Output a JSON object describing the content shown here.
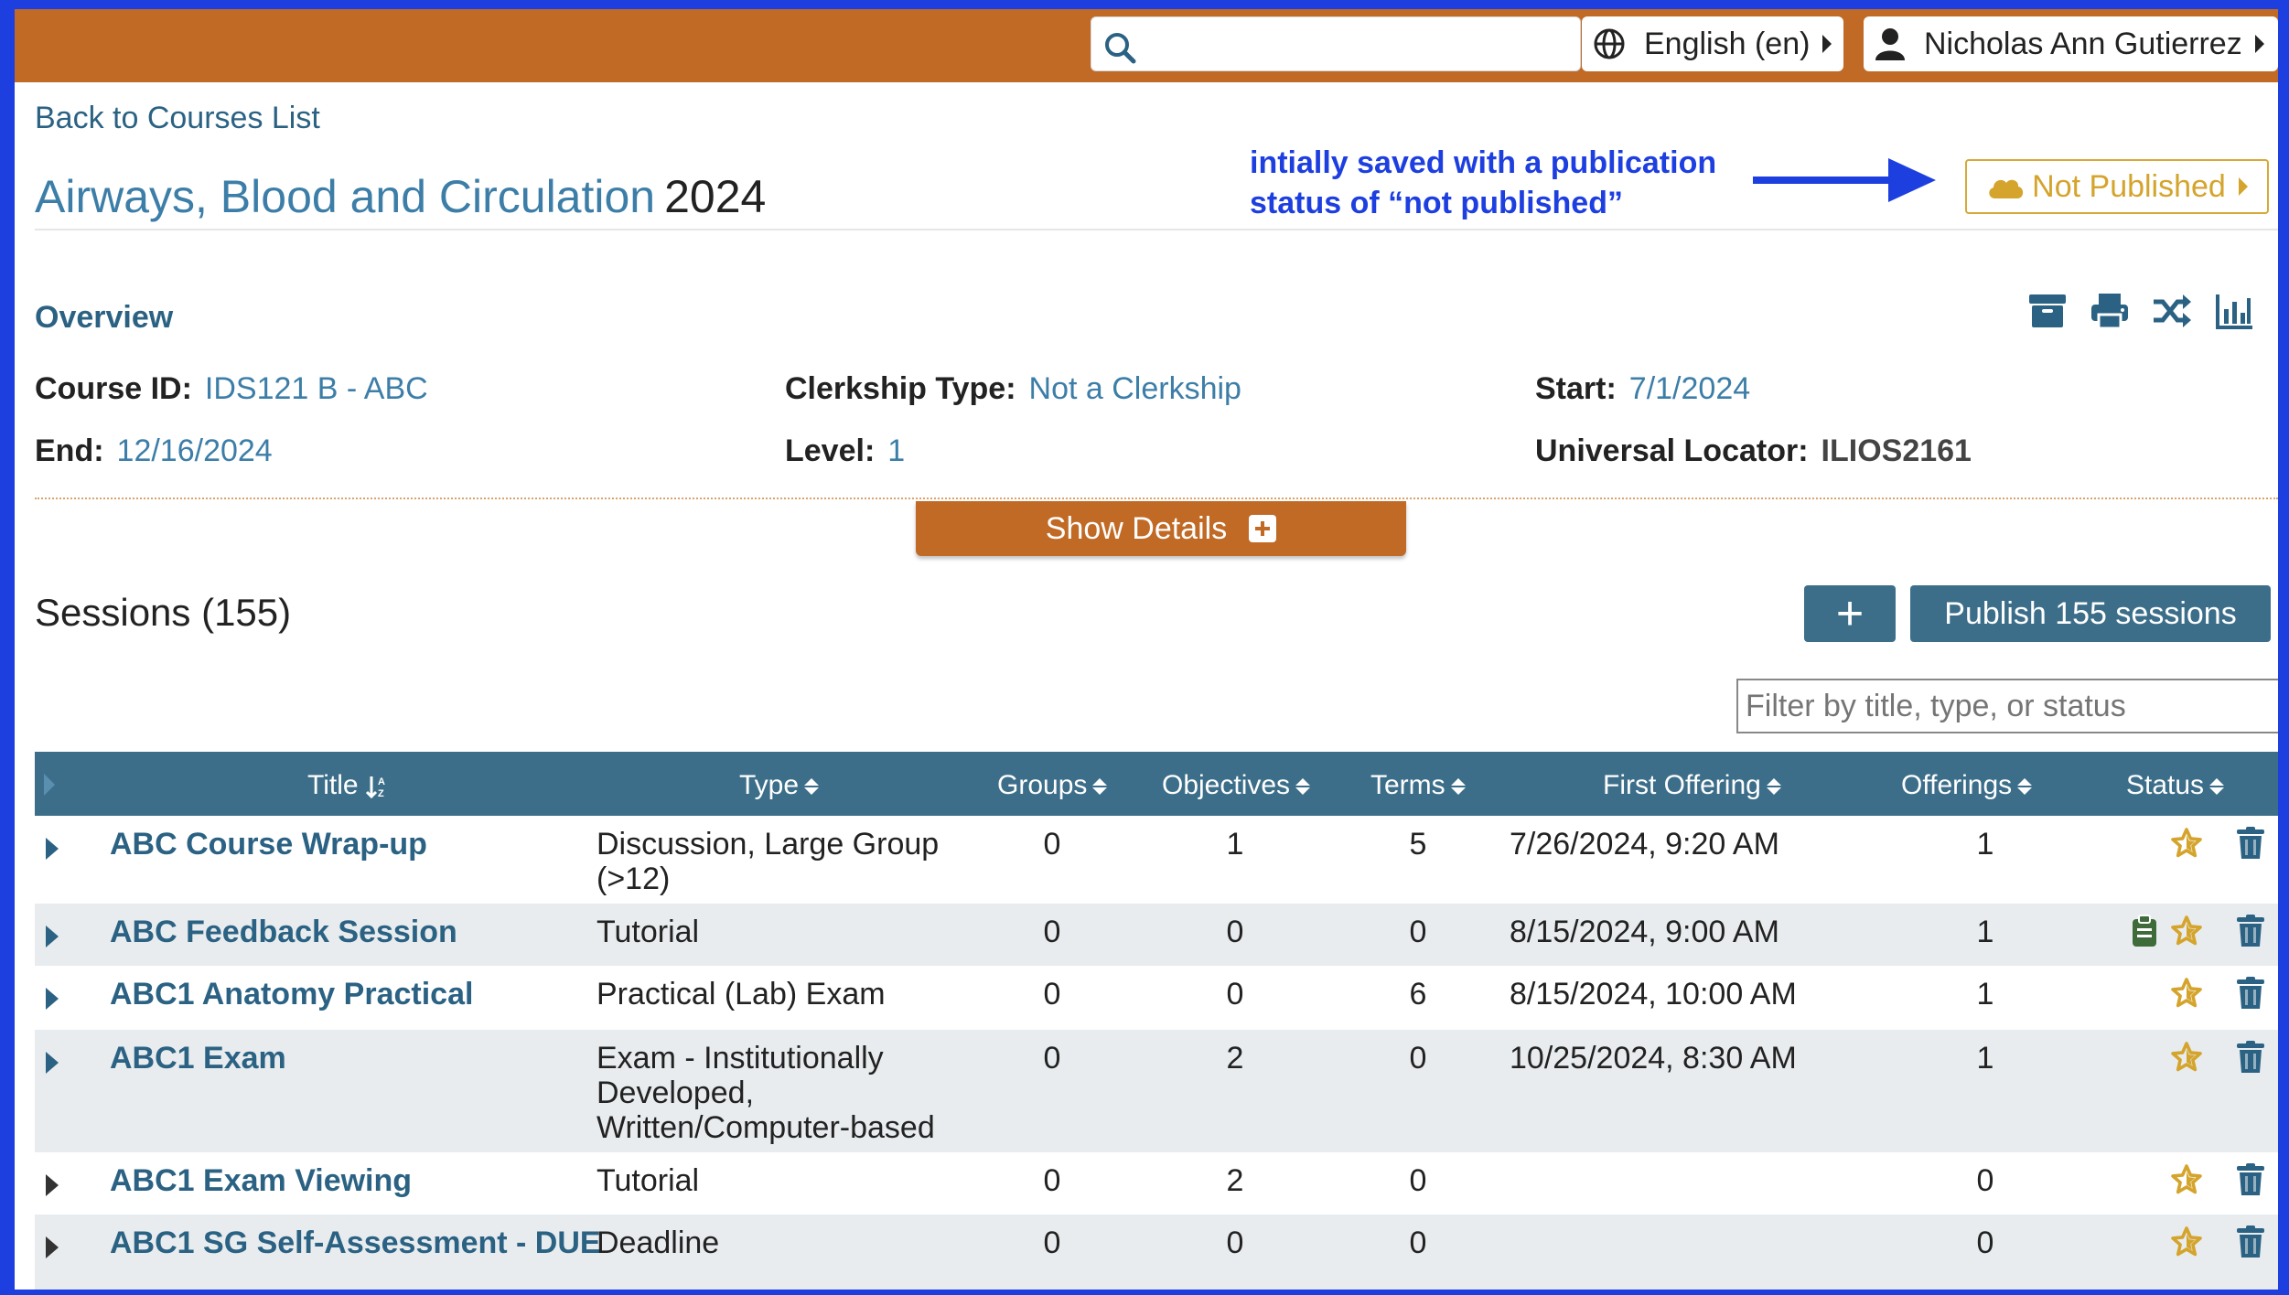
{
  "header": {
    "search_placeholder": "",
    "language": "English (en)",
    "user_name": "Nicholas Ann Gutierrez"
  },
  "nav": {
    "back_link": "Back to Courses List"
  },
  "course": {
    "title": "Airways, Blood and Circulation",
    "year": "2024",
    "publish_status": "Not Published"
  },
  "annotation": {
    "line1": "intially saved with a publication",
    "line2": "status of “not published”"
  },
  "overview": {
    "heading": "Overview",
    "fields": {
      "course_id_label": "Course ID:",
      "course_id": "IDS121 B - ABC",
      "clerkship_label": "Clerkship Type:",
      "clerkship": "Not a Clerkship",
      "start_label": "Start:",
      "start": "7/1/2024",
      "end_label": "End:",
      "end": "12/16/2024",
      "level_label": "Level:",
      "level": "1",
      "locator_label": "Universal Locator:",
      "locator": "ILIOS2161"
    },
    "show_details": "Show Details",
    "tool_icons": [
      "archive-icon",
      "print-icon",
      "shuffle-icon",
      "chart-icon"
    ]
  },
  "sessions": {
    "heading": "Sessions (155)",
    "add_label": "+",
    "publish_label": "Publish 155 sessions",
    "filter_placeholder": "Filter by title, type, or status",
    "columns": {
      "title": "Title",
      "type": "Type",
      "groups": "Groups",
      "objectives": "Objectives",
      "terms": "Terms",
      "first_offering": "First Offering",
      "offerings": "Offerings",
      "status": "Status"
    },
    "rows": [
      {
        "title": "ABC Course Wrap-up",
        "type": "Discussion, Large Group (>12)",
        "groups": "0",
        "objectives": "1",
        "terms": "5",
        "first_offering": "7/26/2024, 9:20 AM",
        "offerings": "1",
        "status_icons": [
          "star-icon"
        ],
        "expand_color": "#2b6283"
      },
      {
        "title": "ABC Feedback Session",
        "type": "Tutorial",
        "groups": "0",
        "objectives": "0",
        "terms": "0",
        "first_offering": "8/15/2024, 9:00 AM",
        "offerings": "1",
        "status_icons": [
          "clipboard-icon",
          "star-icon"
        ],
        "expand_color": "#2b6283"
      },
      {
        "title": "ABC1 Anatomy Practical",
        "type": "Practical (Lab) Exam",
        "groups": "0",
        "objectives": "0",
        "terms": "6",
        "first_offering": "8/15/2024, 10:00 AM",
        "offerings": "1",
        "status_icons": [
          "star-icon"
        ],
        "expand_color": "#2b6283"
      },
      {
        "title": "ABC1 Exam",
        "type": "Exam - Institutionally Developed, Written/Computer-based",
        "groups": "0",
        "objectives": "2",
        "terms": "0",
        "first_offering": "10/25/2024, 8:30 AM",
        "offerings": "1",
        "status_icons": [
          "star-icon"
        ],
        "expand_color": "#2b6283"
      },
      {
        "title": "ABC1 Exam Viewing",
        "type": "Tutorial",
        "groups": "0",
        "objectives": "2",
        "terms": "0",
        "first_offering": "",
        "offerings": "0",
        "status_icons": [
          "star-icon"
        ],
        "expand_color": "#333333"
      },
      {
        "title": "ABC1 SG Self-Assessment - DUE",
        "type": "Deadline",
        "groups": "0",
        "objectives": "0",
        "terms": "0",
        "first_offering": "",
        "offerings": "0",
        "status_icons": [
          "star-icon"
        ],
        "expand_color": "#333333"
      }
    ]
  },
  "colors": {
    "header_bg": "#c06a26",
    "accent": "#3c6e8a",
    "link": "#2b6283",
    "star": "#d4a42c",
    "annotation": "#1e3fe0"
  }
}
